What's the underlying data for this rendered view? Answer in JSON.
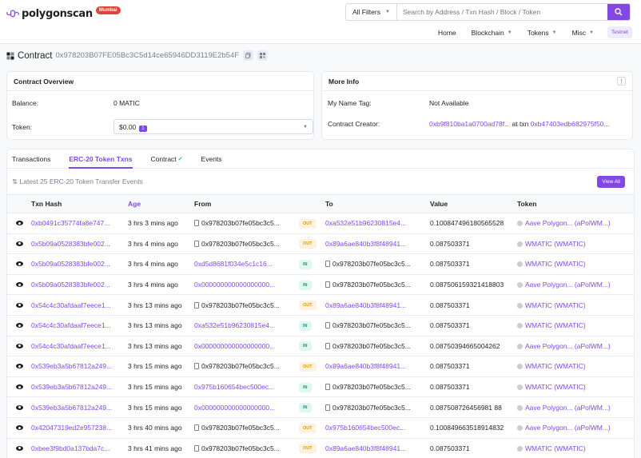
{
  "brand": {
    "name": "polygonscan",
    "network_badge": "Mumbai"
  },
  "search": {
    "filter_label": "All Filters",
    "placeholder": "Search by Address / Txn Hash / Block / Token"
  },
  "nav": {
    "home": "Home",
    "blockchain": "Blockchain",
    "tokens": "Tokens",
    "misc": "Misc",
    "testnet": "Testnet"
  },
  "contract": {
    "label": "Contract",
    "address": "0x978203B07FE05Bc3C5d14ce65946DD3119E2b54F"
  },
  "overview": {
    "title": "Contract Overview",
    "balance_label": "Balance:",
    "balance_value": "0 MATIC",
    "token_label": "Token:",
    "token_value": "$0.00",
    "token_count": "1"
  },
  "more_info": {
    "title": "More Info",
    "name_tag_label": "My Name Tag:",
    "name_tag_value": "Not Available",
    "creator_label": "Contract Creator:",
    "creator_address": "0xb9f810ba1a0700ad78f...",
    "creator_at_txn": "at txn",
    "creator_txn": "0xb47403edb682975f50..."
  },
  "tabs": [
    "Transactions",
    "ERC-20 Token Txns",
    "Contract",
    "Events"
  ],
  "active_tab": 1,
  "subheader": {
    "text": "Latest 25 ERC-20 Token Transfer Events",
    "view_all": "View All"
  },
  "table": {
    "headers": {
      "hash": "Txn Hash",
      "age": "Age",
      "from": "From",
      "to": "To",
      "value": "Value",
      "token": "Token"
    },
    "rows": [
      {
        "hash": "0xb0491c35774fa8e747...",
        "age": "3 hrs 3 mins ago",
        "from": "0x978203b07fe05bc3c5...",
        "from_link": false,
        "dir": "OUT",
        "to": "0xa532e51b96230815e4...",
        "to_link": true,
        "value": "0.100847496180565528",
        "token": "Aave Polygon... (aPolWM...)"
      },
      {
        "hash": "0x5b09a0528383bfe002...",
        "age": "3 hrs 4 mins ago",
        "from": "0x978203b07fe05bc3c5...",
        "from_link": false,
        "dir": "OUT",
        "to": "0x89a6ae840b3f8f48941...",
        "to_link": true,
        "value": "0.087503371",
        "token": "WMATIC (WMATIC)"
      },
      {
        "hash": "0x5b09a0528383bfe002...",
        "age": "3 hrs 4 mins ago",
        "from": "0xd5d8681f034e5c1c16...",
        "from_link": true,
        "dir": "IN",
        "to": "0x978203b07fe05bc3c5...",
        "to_link": false,
        "value": "0.087503371",
        "token": "WMATIC (WMATIC)"
      },
      {
        "hash": "0x5b09a0528383bfe002...",
        "age": "3 hrs 4 mins ago",
        "from": "0x000000000000000000...",
        "from_link": true,
        "dir": "IN",
        "to": "0x978203b07fe05bc3c5...",
        "to_link": false,
        "value": "0.087506159321418803",
        "token": "Aave Polygon... (aPolWM...)"
      },
      {
        "hash": "0x54c4c30afdaaf7eece1...",
        "age": "3 hrs 13 mins ago",
        "from": "0x978203b07fe05bc3c5...",
        "from_link": false,
        "dir": "OUT",
        "to": "0x89a6ae840b3f8f48941...",
        "to_link": true,
        "value": "0.087503371",
        "token": "WMATIC (WMATIC)"
      },
      {
        "hash": "0x54c4c30afdaaf7eece1...",
        "age": "3 hrs 13 mins ago",
        "from": "0xa532e51b96230815e4...",
        "from_link": true,
        "dir": "IN",
        "to": "0x978203b07fe05bc3c5...",
        "to_link": false,
        "value": "0.087503371",
        "token": "WMATIC (WMATIC)"
      },
      {
        "hash": "0x54c4c30afdaaf7eece1...",
        "age": "3 hrs 13 mins ago",
        "from": "0x000000000000000000...",
        "from_link": true,
        "dir": "IN",
        "to": "0x978203b07fe05bc3c5...",
        "to_link": false,
        "value": "0.08750394665004262",
        "token": "Aave Polygon... (aPolWM...)"
      },
      {
        "hash": "0x539eb3a5b67812a249...",
        "age": "3 hrs 15 mins ago",
        "from": "0x978203b07fe05bc3c5...",
        "from_link": false,
        "dir": "OUT",
        "to": "0x89a6ae840b3f8f48941...",
        "to_link": true,
        "value": "0.087503371",
        "token": "WMATIC (WMATIC)"
      },
      {
        "hash": "0x539eb3a5b67812a249...",
        "age": "3 hrs 15 mins ago",
        "from": "0x975b160654bec500ec...",
        "from_link": true,
        "dir": "IN",
        "to": "0x978203b07fe05bc3c5...",
        "to_link": false,
        "value": "0.087503371",
        "token": "WMATIC (WMATIC)"
      },
      {
        "hash": "0x539eb3a5b67812a249...",
        "age": "3 hrs 15 mins ago",
        "from": "0x000000000000000000...",
        "from_link": true,
        "dir": "IN",
        "to": "0x978203b07fe05bc3c5...",
        "to_link": false,
        "value": "0.087508726456981 88",
        "token": "Aave Polygon... (aPolWM...)"
      },
      {
        "hash": "0x42047319ed2e957238...",
        "age": "3 hrs 40 mins ago",
        "from": "0x978203b07fe05bc3c5...",
        "from_link": false,
        "dir": "OUT",
        "to": "0x975b160654bec500ec...",
        "to_link": true,
        "value": "0.100849663518914832",
        "token": "Aave Polygon... (aPolWM...)"
      },
      {
        "hash": "0xbee3f9bd0a137bda7c...",
        "age": "3 hrs 41 mins ago",
        "from": "0x978203b07fe05bc3c5...",
        "from_link": false,
        "dir": "OUT",
        "to": "0x89a6ae840b3f8f48941...",
        "to_link": true,
        "value": "0.087503371",
        "token": "WMATIC (WMATIC)"
      }
    ]
  },
  "colors": {
    "accent": "#8247e5",
    "out": "#db9a04",
    "in": "#00a186",
    "badge_red": "#de4437"
  }
}
